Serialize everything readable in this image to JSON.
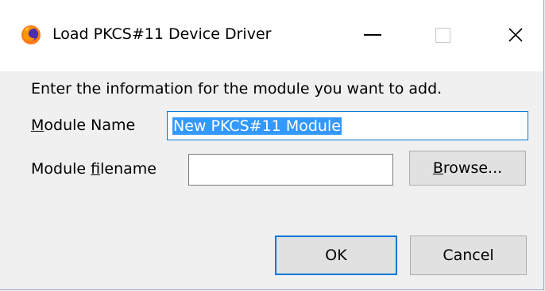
{
  "window": {
    "title": "Load PKCS#11 Device Driver",
    "app_icon": "firefox-icon",
    "controls": {
      "minimize_icon": "minimize-icon",
      "maximize_icon": "maximize-icon",
      "close_icon": "close-icon",
      "close_glyph": "✕"
    }
  },
  "dialog": {
    "instruction": "Enter the information for the module you want to add.",
    "module_name": {
      "label_accel": "M",
      "label_rest": "odule Name",
      "value": "New PKCS#11 Module",
      "selected": true
    },
    "module_filename": {
      "label_pre": "Module ",
      "label_accel": "f",
      "label_rest": "ilename",
      "value": ""
    },
    "browse_button": {
      "accel": "B",
      "rest": "rowse..."
    },
    "ok_button": "OK",
    "cancel_button": "Cancel"
  },
  "colors": {
    "selection": "#3399ff",
    "focus_border": "#0078d7",
    "background": "#f0f0f0"
  }
}
